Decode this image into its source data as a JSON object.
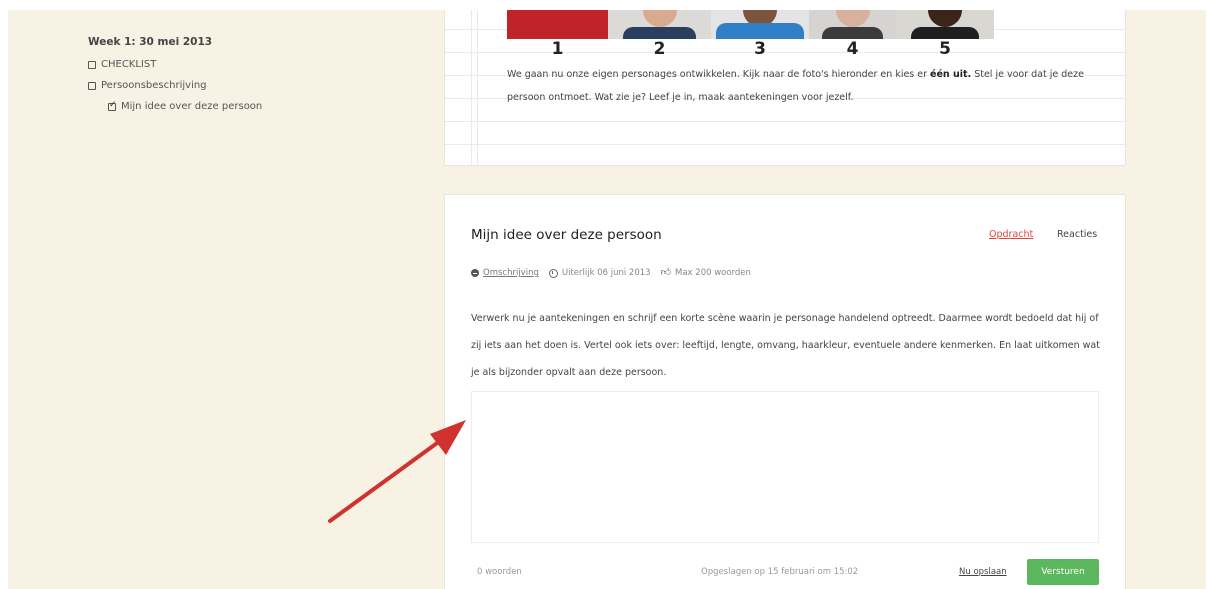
{
  "sidebar": {
    "week_title": "Week 1: 30 mei 2013",
    "items": [
      {
        "label": "CHECKLIST",
        "checked": false
      },
      {
        "label": "Persoonsbeschrijving",
        "checked": false
      },
      {
        "label": "Mijn idee over deze persoon",
        "checked": true
      }
    ]
  },
  "intro": {
    "photo_numbers": [
      "1",
      "2",
      "3",
      "4",
      "5"
    ],
    "text_before": "We gaan nu onze eigen personages ontwikkelen. Kijk naar de foto's hieronder en kies er ",
    "text_bold": "één uit.",
    "text_after": " Stel je voor dat je deze persoon ontmoet. Wat zie je? Leef je in, maak aantekeningen voor jezelf."
  },
  "assignment": {
    "title": "Mijn idee over deze persoon",
    "tab_assignment": "Opdracht",
    "tab_reactions": "Reacties",
    "meta_description": "Omschrijving",
    "meta_deadline": "Uiterlijk 06 juni 2013",
    "meta_limit": "Max 200 woorden",
    "body": "Verwerk nu je aantekeningen en schrijf een korte scène waarin je personage handelend optreedt. Daarmee wordt bedoeld dat hij of zij iets aan het doen is. Vertel ook iets over: leeftijd, lengte, omvang, haarkleur, eventuele andere kenmerken. En laat uitkomen wat je als bijzonder opvalt aan deze persoon.",
    "answer_value": "",
    "word_count": "0 woorden",
    "saved_at": "Opgeslagen op 15 februari om 15:02",
    "save_now": "Nu opslaan",
    "send": "Versturen"
  },
  "colors": {
    "background": "#f7f2e4",
    "accent_link": "#e0463b",
    "send_button": "#5cb85c",
    "arrow": "#d0322e"
  }
}
